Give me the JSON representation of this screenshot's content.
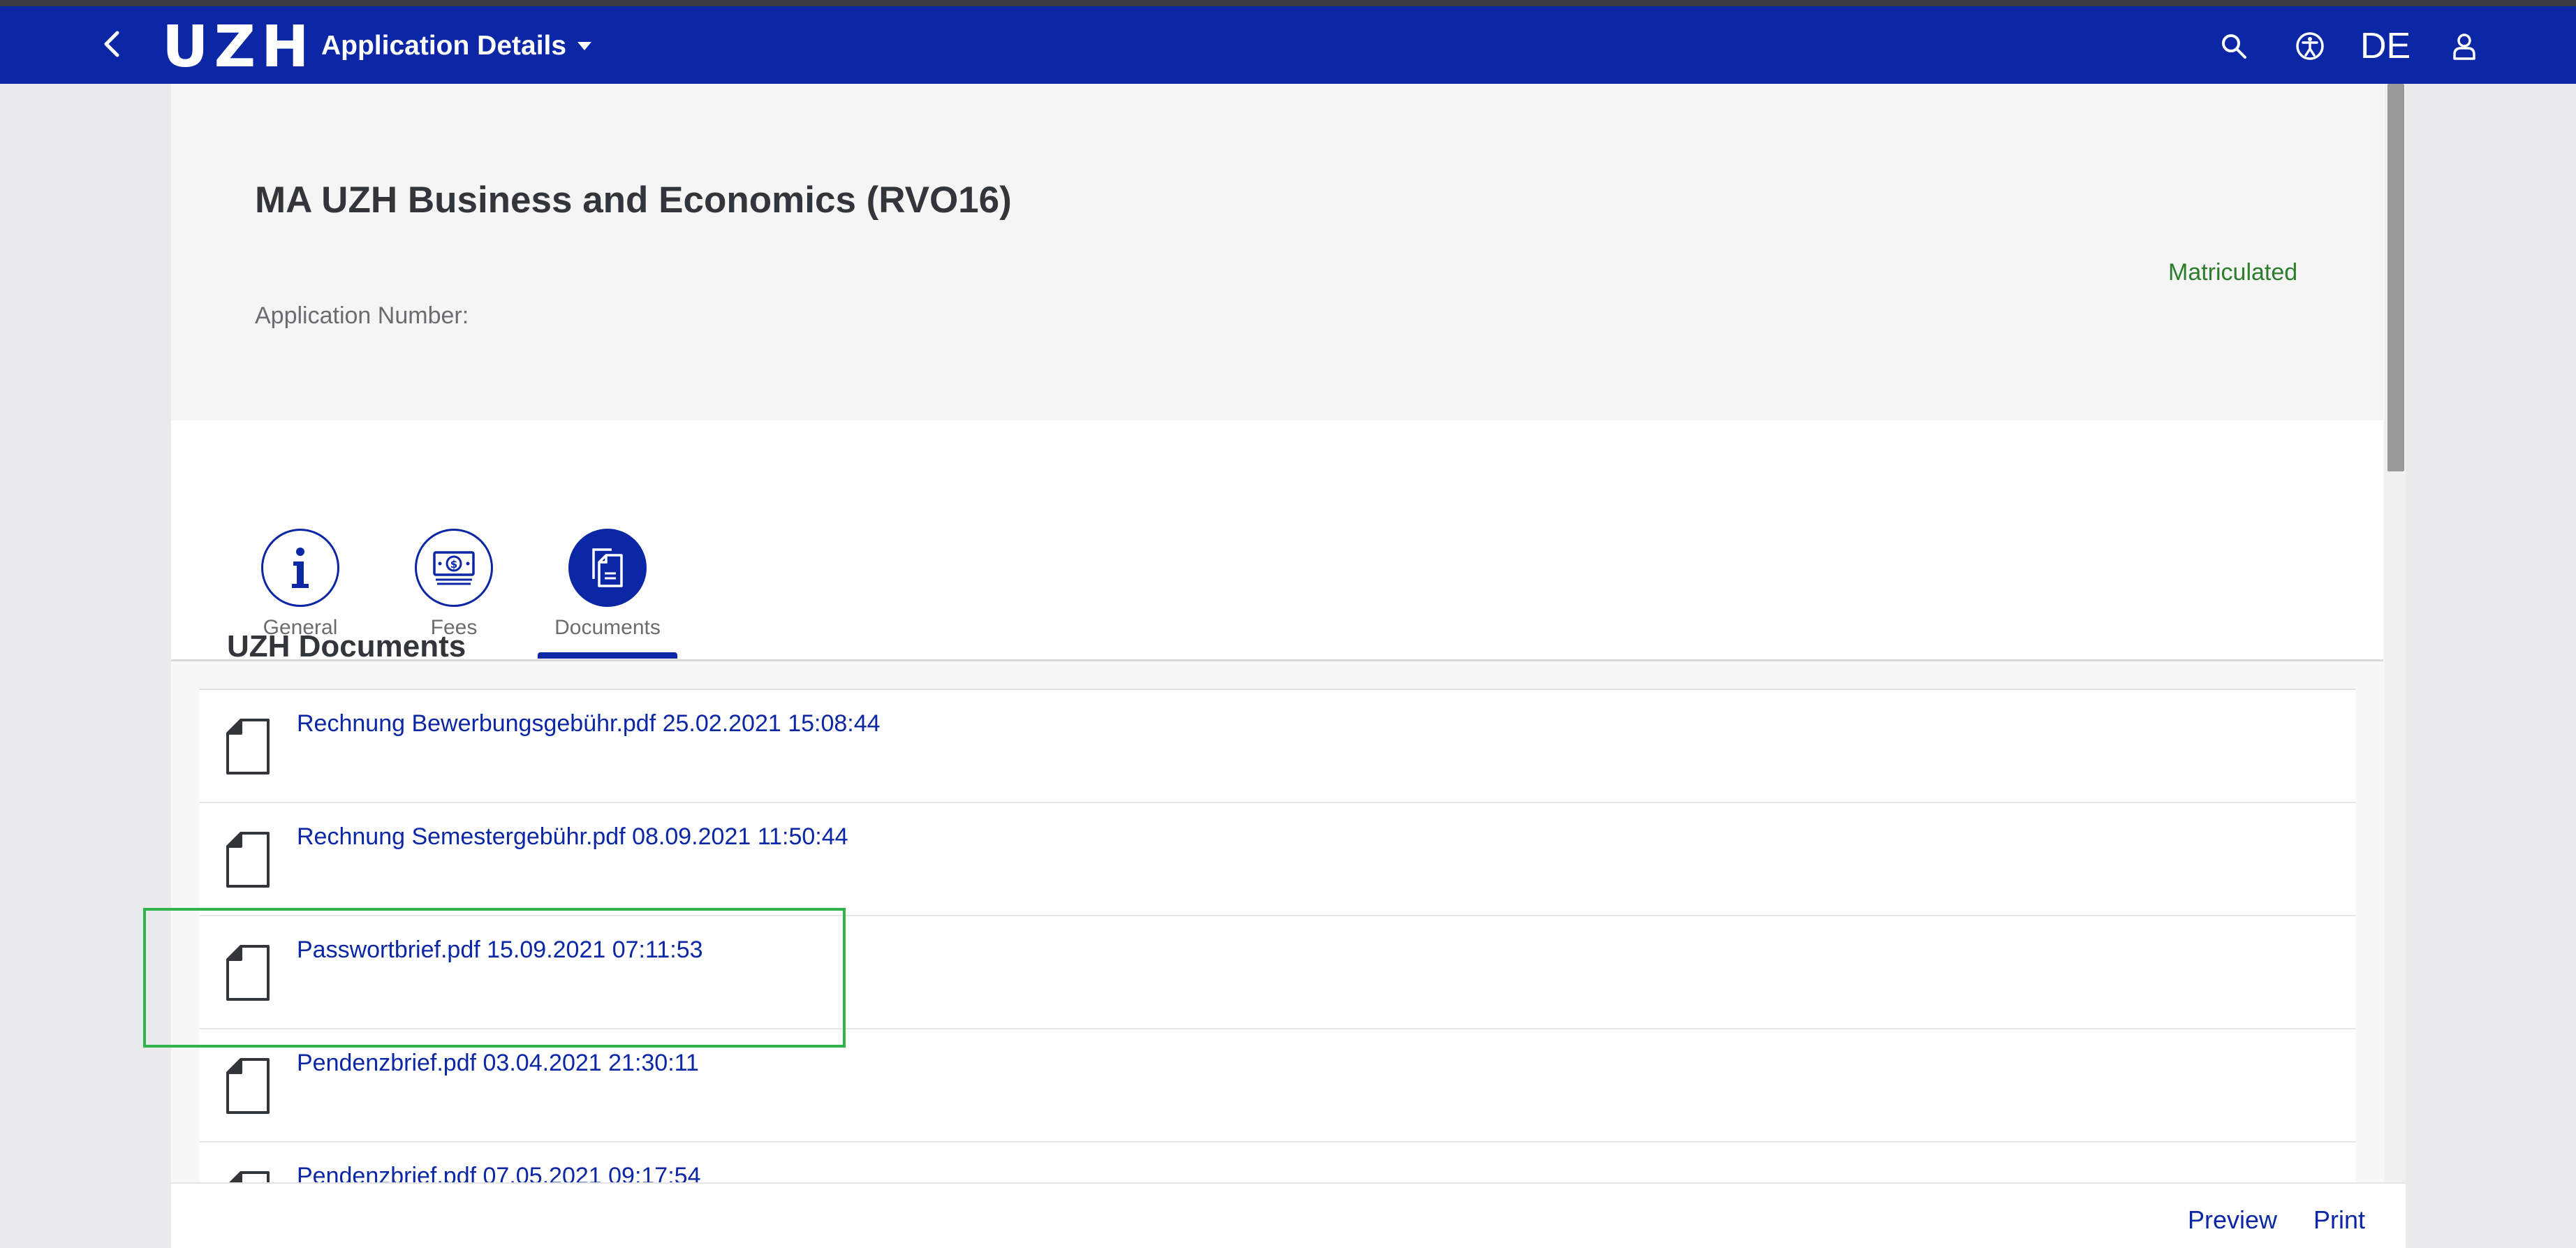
{
  "shell": {
    "logo": "UZH",
    "app_title": "Application Details",
    "language": "DE",
    "colors": {
      "brand": "#0b27a6",
      "status_success": "#2b7c2b",
      "highlight": "#2fb34a"
    },
    "icons": [
      "back-icon",
      "search-icon",
      "accessibility-icon",
      "user-icon"
    ]
  },
  "header": {
    "title": "MA UZH Business and Economics (RVO16)",
    "application_number_label": "Application Number:",
    "application_number_value": "",
    "status": "Matriculated"
  },
  "tabs": [
    {
      "label": "General",
      "icon": "info-icon",
      "active": false
    },
    {
      "label": "Fees",
      "icon": "money-icon",
      "active": false
    },
    {
      "label": "Documents",
      "icon": "documents-icon",
      "active": true
    }
  ],
  "documents": {
    "section_title": "UZH Documents",
    "items": [
      {
        "label": "Rechnung Bewerbungsgebühr.pdf 25.02.2021 15:08:44"
      },
      {
        "label": "Rechnung Semestergebühr.pdf 08.09.2021 11:50:44"
      },
      {
        "label": "Passwortbrief.pdf 15.09.2021 07:11:53"
      },
      {
        "label": "Pendenzbrief.pdf 03.04.2021 21:30:11"
      },
      {
        "label": "Pendenzbrief.pdf 07.05.2021 09:17:54"
      }
    ]
  },
  "footer": {
    "preview_label": "Preview",
    "print_label": "Print"
  }
}
